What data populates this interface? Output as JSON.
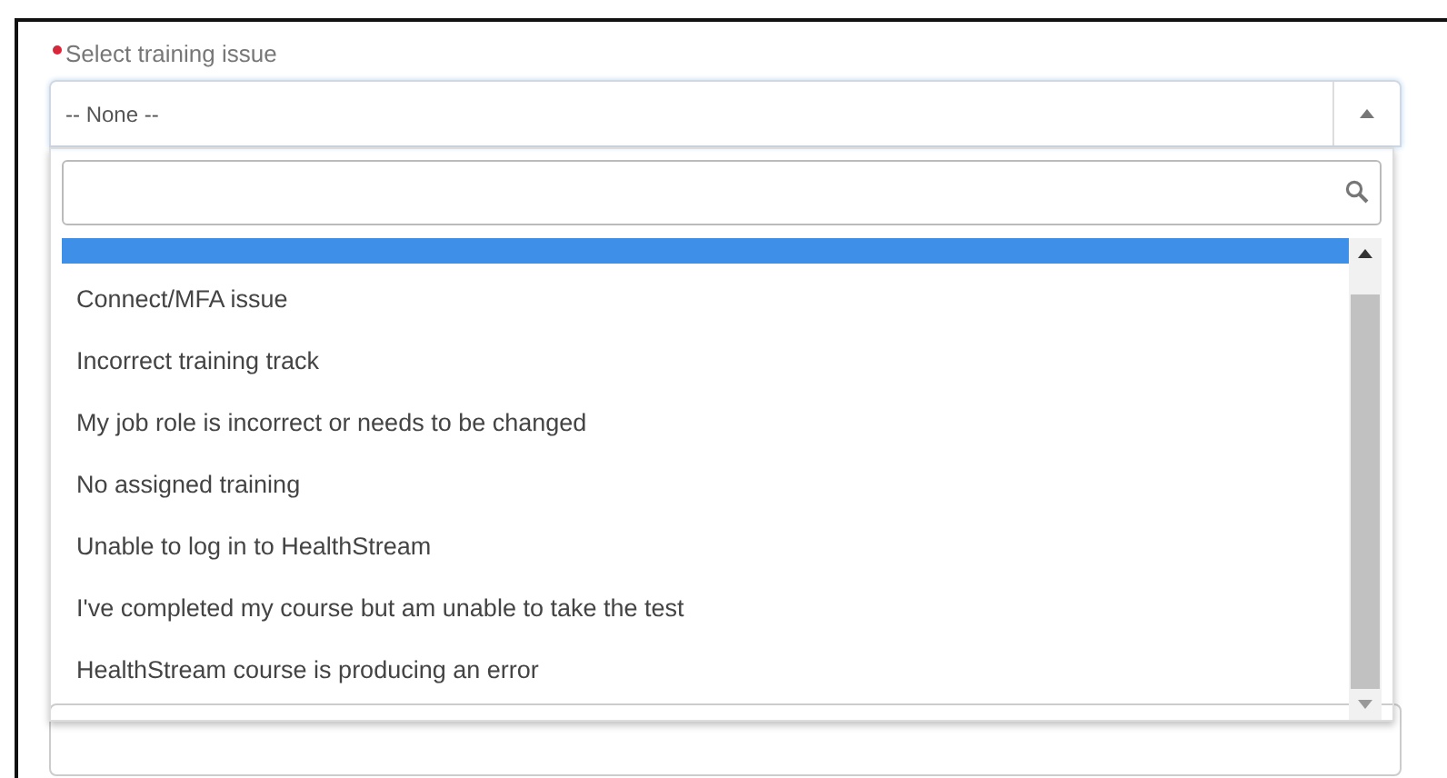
{
  "field": {
    "label": "Select training issue",
    "required": true,
    "value": "-- None --",
    "expanded": true
  },
  "dropdown": {
    "options": [
      {
        "selected": true
      },
      {
        "label": "Connect/MFA issue",
        "selected": false
      },
      {
        "label": "Incorrect training track",
        "selected": false
      },
      {
        "label": "My job role is incorrect or needs to be changed",
        "selected": false
      },
      {
        "label": "No assigned training",
        "selected": false
      },
      {
        "label": "Unable to log in to HealthStream",
        "selected": false
      },
      {
        "label": "I've completed my course but am unable to take the test",
        "selected": false
      },
      {
        "label": "HealthStream course is producing an error",
        "selected": false
      }
    ]
  }
}
